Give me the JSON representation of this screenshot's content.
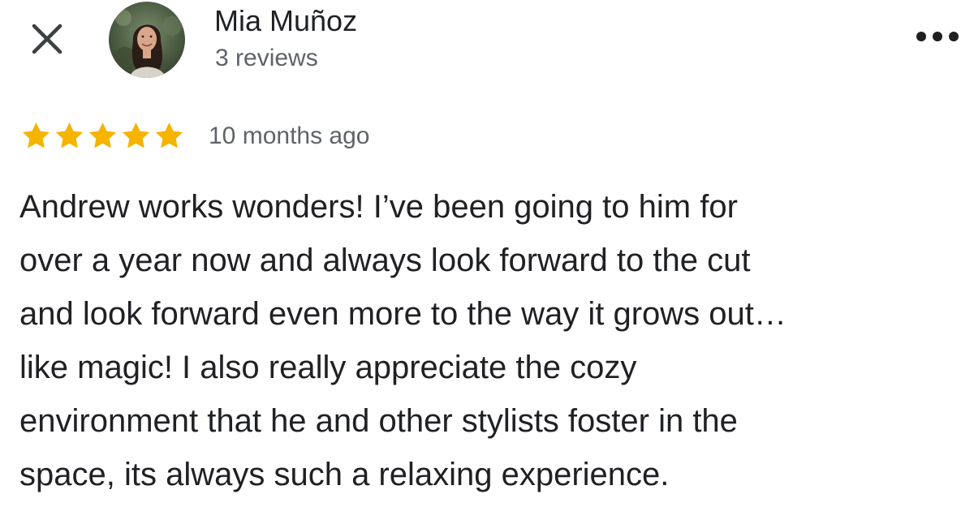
{
  "review": {
    "author": {
      "name": "Mia Muñoz",
      "review_count": "3 reviews",
      "avatar_icon": "profile-photo"
    },
    "rating": 5,
    "max_rating": 5,
    "star_color": "#F4B400",
    "time": "10 months ago",
    "text_lines": [
      "Andrew works wonders! I’ve been going to him for",
      "over a year now and always look forward to the cut",
      "and look forward even more to the way it grows out…",
      "like magic! I also really appreciate the cozy",
      "environment that he and other stylists foster in the",
      "space, its always such a relaxing experience."
    ]
  },
  "icons": {
    "close": "close-icon",
    "more": "more-options-icon",
    "star": "star-icon"
  }
}
